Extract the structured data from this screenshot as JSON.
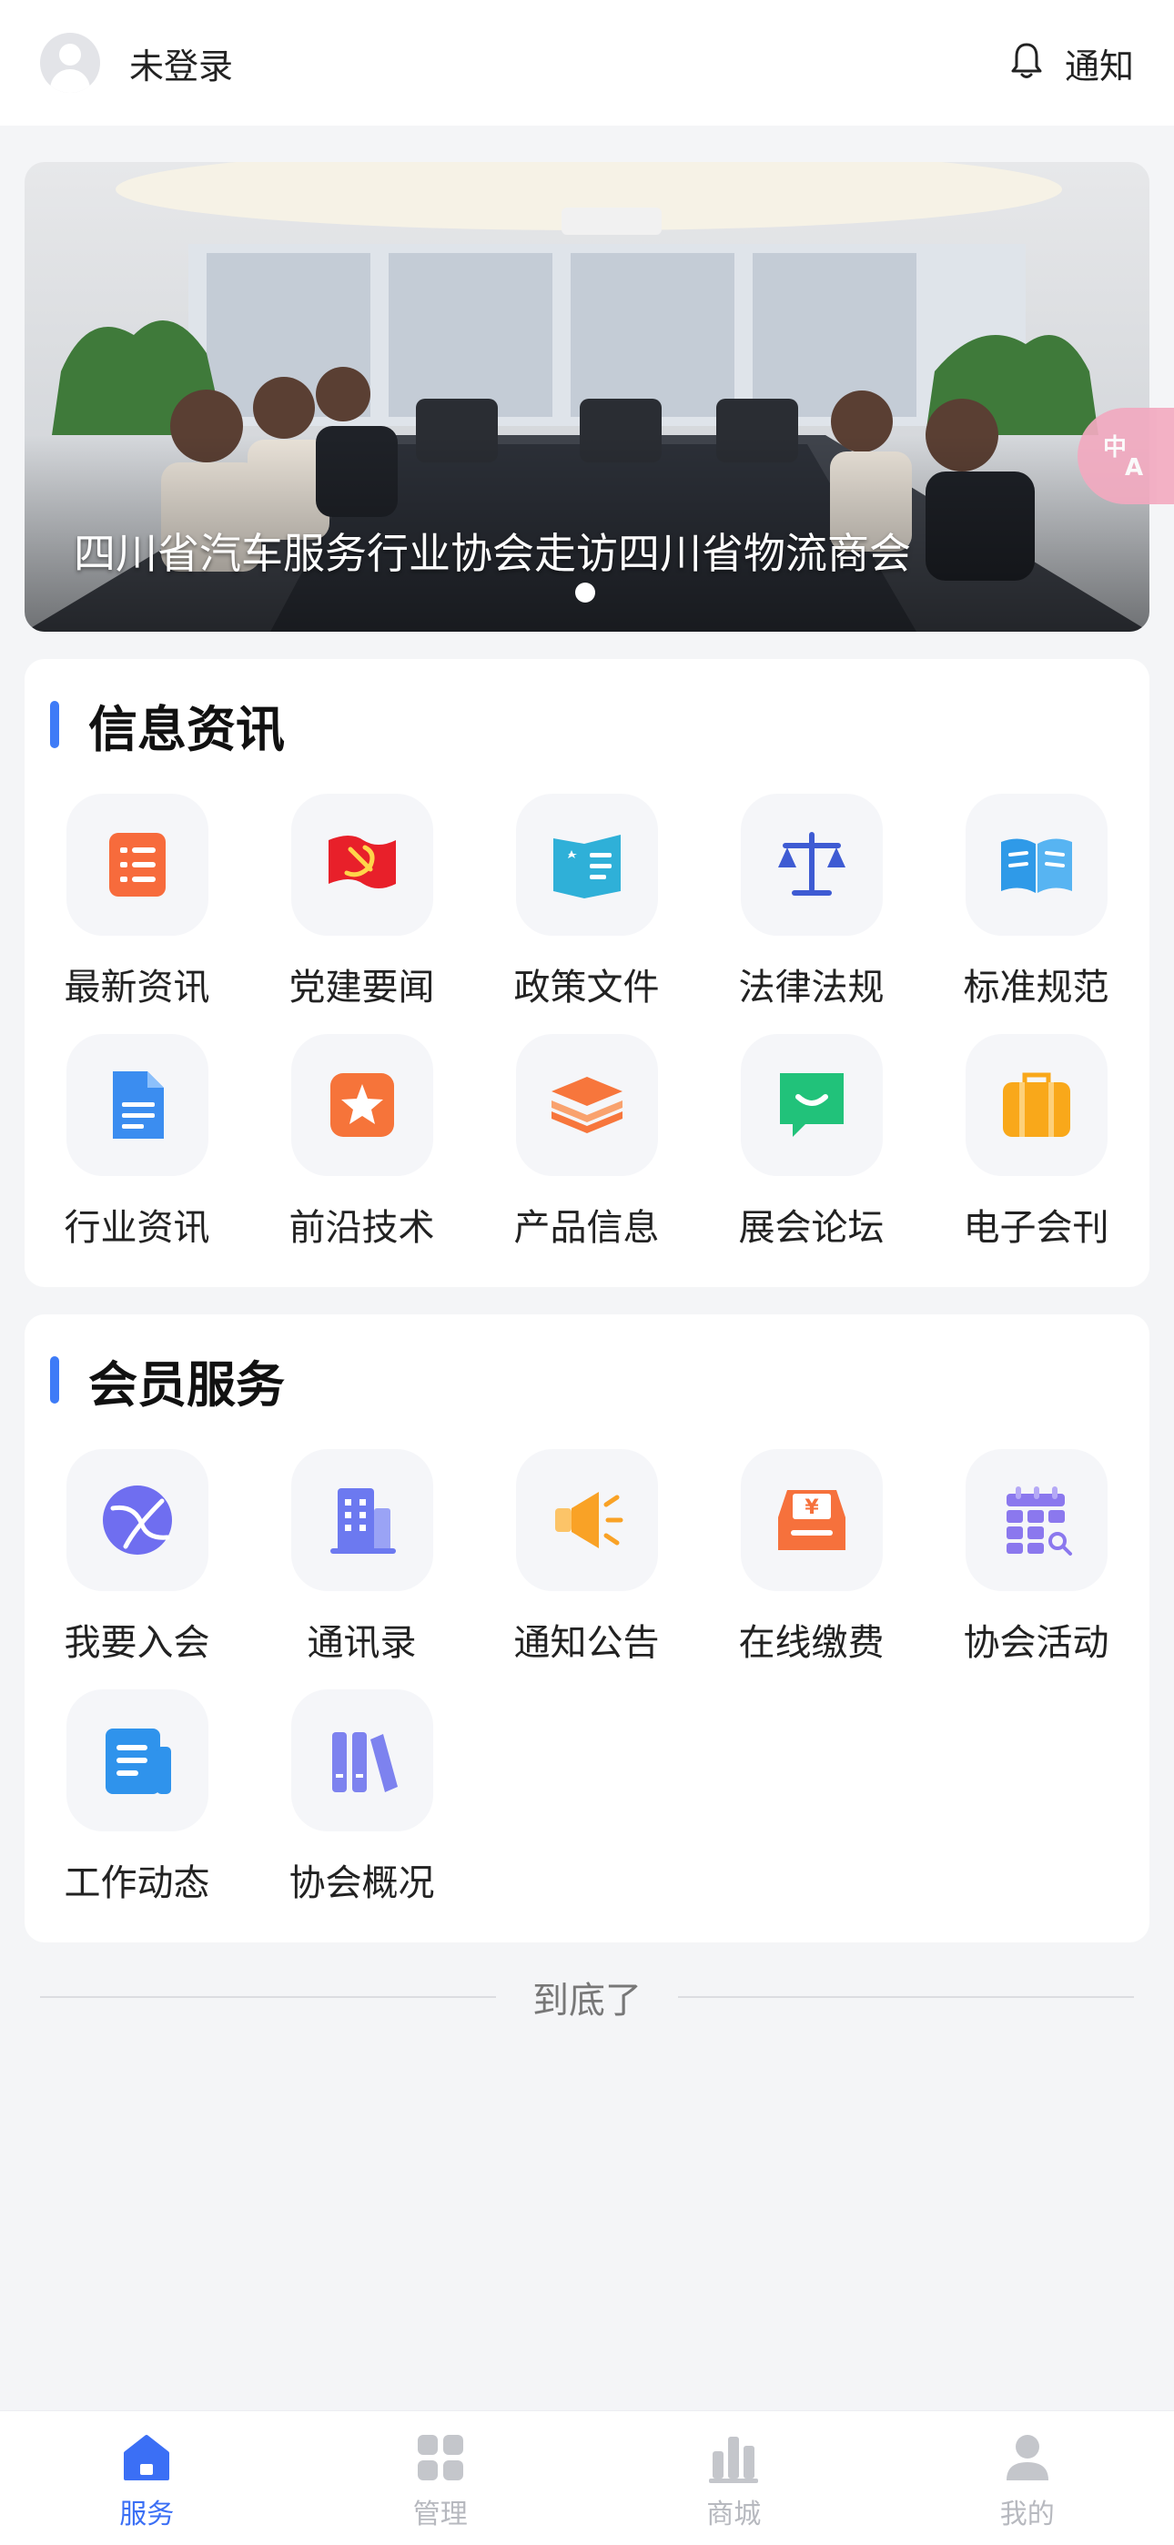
{
  "header": {
    "user_label": "未登录",
    "notify_label": "通知"
  },
  "banner": {
    "caption": "四川省汽车服务行业协会走访四川省物流商会",
    "active_slide": 1,
    "slide_count": 1
  },
  "info_section": {
    "title": "信息资讯",
    "items": [
      {
        "label": "最新资讯",
        "icon": "list-document-icon",
        "color": "#f76b3c"
      },
      {
        "label": "党建要闻",
        "icon": "party-flag-icon",
        "color": "#e8202a"
      },
      {
        "label": "政策文件",
        "icon": "policy-book-icon",
        "color": "#2fb0d8"
      },
      {
        "label": "法律法规",
        "icon": "scales-icon",
        "color": "#3e5bd3"
      },
      {
        "label": "标准规范",
        "icon": "open-book-icon",
        "color": "#2f9ae8"
      },
      {
        "label": "行业资讯",
        "icon": "file-document-icon",
        "color": "#3b8df0"
      },
      {
        "label": "前沿技术",
        "icon": "star-badge-icon",
        "color": "#f6743a"
      },
      {
        "label": "产品信息",
        "icon": "layers-icon",
        "color": "#f7763c"
      },
      {
        "label": "展会论坛",
        "icon": "chat-bubble-icon",
        "color": "#21c27a"
      },
      {
        "label": "电子会刊",
        "icon": "briefcase-icon",
        "color": "#f9a81a"
      }
    ]
  },
  "member_section": {
    "title": "会员服务",
    "items": [
      {
        "label": "我要入会",
        "icon": "globe-icon",
        "color": "#6f6ef0"
      },
      {
        "label": "通讯录",
        "icon": "building-icon",
        "color": "#6c79f0"
      },
      {
        "label": "通知公告",
        "icon": "megaphone-icon",
        "color": "#f9a226"
      },
      {
        "label": "在线缴费",
        "icon": "payment-box-icon",
        "color": "#f6713c"
      },
      {
        "label": "协会活动",
        "icon": "calendar-grid-icon",
        "color": "#8b78ee"
      },
      {
        "label": "工作动态",
        "icon": "news-icon",
        "color": "#2f93ec"
      },
      {
        "label": "协会概况",
        "icon": "books-icon",
        "color": "#7d82ef"
      }
    ]
  },
  "end_text": "到底了",
  "tabbar": {
    "tabs": [
      {
        "label": "服务",
        "icon": "home-icon",
        "active": true
      },
      {
        "label": "管理",
        "icon": "grid-icon",
        "active": false
      },
      {
        "label": "商城",
        "icon": "chart-bars-icon",
        "active": false
      },
      {
        "label": "我的",
        "icon": "person-icon",
        "active": false
      }
    ],
    "active_color": "#3b6ff5",
    "inactive_color": "#c4c6cb"
  }
}
